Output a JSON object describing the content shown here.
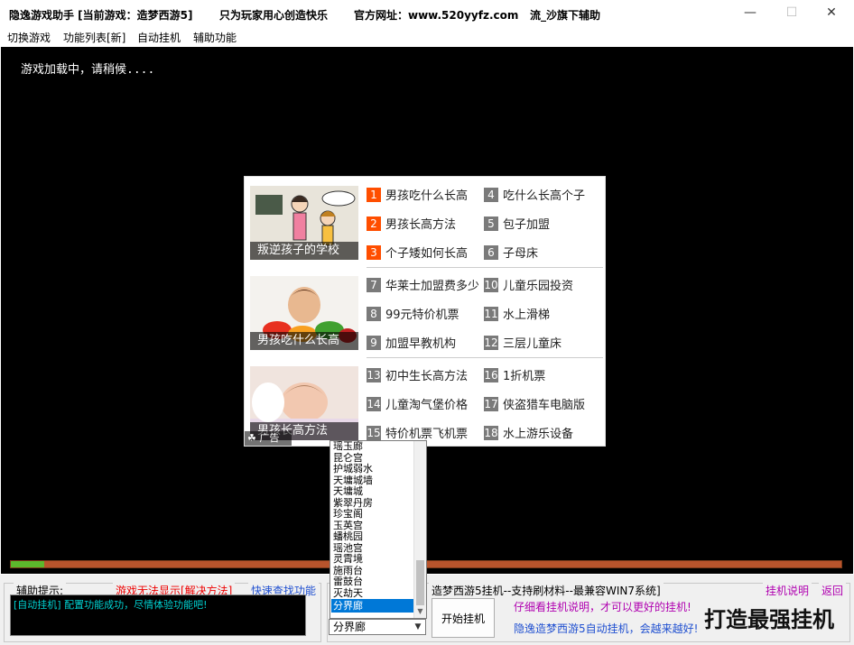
{
  "titlebar": {
    "segments": [
      "隐逸游戏助手 [当前游戏：造梦西游5]",
      "只为玩家用心创造快乐",
      "官方网址：www.520yyfz.com",
      "流_沙旗下辅助"
    ],
    "minimize_glyph": "—",
    "maximize_glyph": "☐",
    "close_glyph": "✕"
  },
  "menu": {
    "items": [
      "切换游戏",
      "功能列表[新]",
      "自动挂机",
      "辅助功能"
    ]
  },
  "game": {
    "loading_text": "游戏加载中，请稍候....",
    "progress_fraction": 0.04
  },
  "ad": {
    "blocks": [
      {
        "caption": "叛逆孩子的学校",
        "links": [
          {
            "num": "1",
            "text": "男孩吃什么长高",
            "hot": true
          },
          {
            "num": "4",
            "text": "吃什么长高个子",
            "hot": false
          },
          {
            "num": "2",
            "text": "男孩长高方法",
            "hot": true
          },
          {
            "num": "5",
            "text": "包子加盟",
            "hot": false
          },
          {
            "num": "3",
            "text": "个子矮如何长高",
            "hot": true
          },
          {
            "num": "6",
            "text": "子母床",
            "hot": false
          }
        ]
      },
      {
        "caption": "男孩吃什么长高",
        "links": [
          {
            "num": "7",
            "text": "华莱士加盟费多少",
            "hot": false
          },
          {
            "num": "10",
            "text": "儿童乐园投资",
            "hot": false
          },
          {
            "num": "8",
            "text": "99元特价机票",
            "hot": false
          },
          {
            "num": "11",
            "text": "水上滑梯",
            "hot": false
          },
          {
            "num": "9",
            "text": "加盟早教机构",
            "hot": false
          },
          {
            "num": "12",
            "text": "三层儿童床",
            "hot": false
          }
        ]
      },
      {
        "caption": "男孩长高方法",
        "links": [
          {
            "num": "13",
            "text": "初中生长高方法",
            "hot": false
          },
          {
            "num": "16",
            "text": "1折机票",
            "hot": false
          },
          {
            "num": "14",
            "text": "儿童淘气堡价格",
            "hot": false
          },
          {
            "num": "17",
            "text": "侠盗猎车电脑版",
            "hot": false
          },
          {
            "num": "15",
            "text": "特价机票飞机票",
            "hot": false
          },
          {
            "num": "18",
            "text": "水上游乐设备",
            "hot": false
          }
        ]
      }
    ],
    "badge": "☘ 广告"
  },
  "hint": {
    "title": "辅助提示:",
    "link_fix": "游戏无法显示[解决方法]",
    "link_search": "快速查找功能",
    "log": "[自动挂机] 配置功能成功，尽情体验功能吧!"
  },
  "autoplay": {
    "title": "造梦西游5挂机--支持刷材料--最兼容WIN7系统]",
    "help_link": "挂机说明",
    "back_link": "返回",
    "start_label": "开始挂机",
    "note1": "仔细看挂机说明，才可以更好的挂机!",
    "note2": "隐逸造梦西游5自动挂机，会越来越好!",
    "brand": "打造最强挂机"
  },
  "map_select": {
    "value": "分界廊",
    "options": [
      "瑶玉廊",
      "昆仑宫",
      "护城弱水",
      "天墉城墙",
      "天墉城",
      "紫翠丹房",
      "珍宝阁",
      "玉英宫",
      "蟠桃园",
      "瑶池宫",
      "灵霄境",
      "施雨台",
      "雷鼓台",
      "灭劫天",
      "分界廊"
    ],
    "selected_index": 14
  },
  "colors": {
    "hot_number": "#ff4e00",
    "progress_fill": "#5cb82c",
    "progress_track": "#b8542c",
    "log_text": "#00d4d4",
    "link_red": "#e00000",
    "link_blue": "#2050d0",
    "link_purple": "#b000b0"
  }
}
